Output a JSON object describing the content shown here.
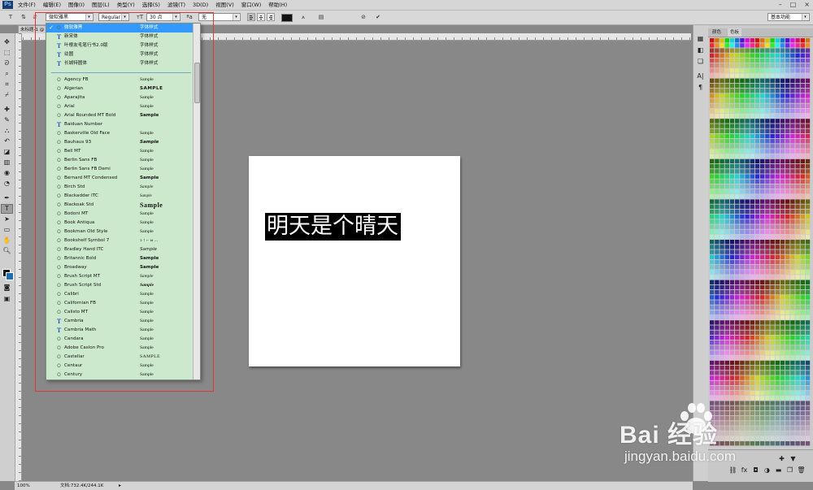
{
  "app": {
    "logo": "Ps",
    "menu": [
      "文件(F)",
      "编辑(E)",
      "图像(I)",
      "图层(L)",
      "类型(Y)",
      "选择(S)",
      "滤镜(T)",
      "3D(D)",
      "视图(V)",
      "窗口(W)",
      "帮助(H)"
    ],
    "window_controls": [
      "–",
      "□",
      "×"
    ]
  },
  "options": {
    "font_family": "微软雅黑",
    "font_style": "Regular",
    "font_size": "30 点",
    "antialias": "无",
    "workspace": "基本功能"
  },
  "document": {
    "tab_title": "未标题-1 @",
    "canvas_text": "明天是个晴天",
    "status_zoom": "100%",
    "status_doc": "文档:732.4K/244.1K"
  },
  "font_list": {
    "cjk_fonts": [
      {
        "name": "微软雅黑",
        "sample": "字体样式",
        "selected": true,
        "type": "o"
      },
      {
        "name": "新宋体",
        "sample": "字体样式",
        "type": "tt"
      },
      {
        "name": "叶根友毛笔行书2.0版",
        "sample": "字体样式",
        "type": "tt"
      },
      {
        "name": "幼圆",
        "sample": "字体样式",
        "type": "tt"
      },
      {
        "name": "长城特圆体",
        "sample": "字体样式",
        "type": "tt"
      }
    ],
    "latin_fonts": [
      {
        "name": "Agency FB",
        "sample": "Sample",
        "type": "o"
      },
      {
        "name": "Algerian",
        "sample": "SAMPLE",
        "type": "o"
      },
      {
        "name": "Aparajita",
        "sample": "Sample",
        "type": "o"
      },
      {
        "name": "Arial",
        "sample": "Sample",
        "type": "o"
      },
      {
        "name": "Arial Rounded MT Bold",
        "sample": "Sample",
        "type": "o"
      },
      {
        "name": "Baiduan Number",
        "sample": "",
        "type": "tt"
      },
      {
        "name": "Baskerville Old Face",
        "sample": "Sample",
        "type": "o"
      },
      {
        "name": "Bauhaus 93",
        "sample": "Sample",
        "type": "o"
      },
      {
        "name": "Bell MT",
        "sample": "Sample",
        "type": "o"
      },
      {
        "name": "Berlin Sans FB",
        "sample": "Sample",
        "type": "o"
      },
      {
        "name": "Berlin Sans FB Demi",
        "sample": "Sample",
        "type": "o"
      },
      {
        "name": "Bernard MT Condensed",
        "sample": "Sample",
        "type": "o"
      },
      {
        "name": "Birch Std",
        "sample": "Sample",
        "type": "o"
      },
      {
        "name": "Blackadder ITC",
        "sample": "Sample",
        "type": "o"
      },
      {
        "name": "Blackoak Std",
        "sample": "Sample",
        "type": "o"
      },
      {
        "name": "Bodoni MT",
        "sample": "Sample",
        "type": "o"
      },
      {
        "name": "Book Antiqua",
        "sample": "Sample",
        "type": "o"
      },
      {
        "name": "Bookman Old Style",
        "sample": "Sample",
        "type": "o"
      },
      {
        "name": "Bookshelf Symbol 7",
        "sample": "ↄ ↑ ⌐ ω ...",
        "type": "o"
      },
      {
        "name": "Bradley Hand ITC",
        "sample": "Sample",
        "type": "o"
      },
      {
        "name": "Britannic Bold",
        "sample": "Sample",
        "type": "o"
      },
      {
        "name": "Broadway",
        "sample": "Sample",
        "type": "o"
      },
      {
        "name": "Brush Script MT",
        "sample": "Sample",
        "type": "o"
      },
      {
        "name": "Brush Script Std",
        "sample": "Sample",
        "type": "o"
      },
      {
        "name": "Calibri",
        "sample": "Sample",
        "type": "o"
      },
      {
        "name": "Californian FB",
        "sample": "Sample",
        "type": "o"
      },
      {
        "name": "Calisto MT",
        "sample": "Sample",
        "type": "o"
      },
      {
        "name": "Cambria",
        "sample": "Sample",
        "type": "tt"
      },
      {
        "name": "Cambria Math",
        "sample": "Sample",
        "type": "tt"
      },
      {
        "name": "Candara",
        "sample": "Sample",
        "type": "o"
      },
      {
        "name": "Adobe Caslon Pro",
        "sample": "Sample",
        "type": "o"
      },
      {
        "name": "Castellar",
        "sample": "SAMPLE",
        "type": "o"
      },
      {
        "name": "Centaur",
        "sample": "Sample",
        "type": "o"
      },
      {
        "name": "Century",
        "sample": "Sample",
        "type": "o"
      }
    ]
  },
  "panel": {
    "tabs": [
      "颜色",
      "色板"
    ],
    "active_tab": "色板"
  },
  "watermark": {
    "brand": "Bai  经验",
    "url": "jingyan.baidu.com"
  }
}
